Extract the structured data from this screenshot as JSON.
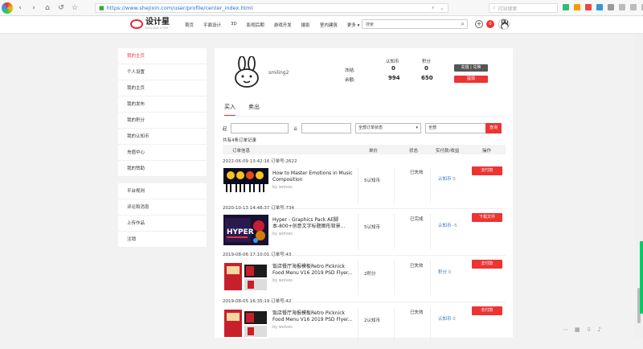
{
  "browser": {
    "url": "https://www.shejixin.com/user/profile/center_index.html",
    "search_placeholder": "闪站搜索",
    "colors": {
      "accent": "#e33333",
      "link": "#2a72c8"
    }
  },
  "header": {
    "logo_text": "设计星",
    "logo_sub": "DESIGN STAR",
    "menu": [
      "首页",
      "平面设计",
      "3D",
      "影视后期",
      "游戏开发",
      "摄影",
      "室内建筑",
      "更多"
    ],
    "search_value": "搜索",
    "notification_count": "0"
  },
  "sidebar": {
    "group1": [
      "我的主页",
      "个人设置",
      "我的主页",
      "我的发布",
      "我的积分",
      "我的认知币",
      "充值中心",
      "我的赞助"
    ],
    "group2": [
      "平台规则",
      "评论和消息",
      "上传作品",
      "注销"
    ]
  },
  "profile": {
    "username": "smiling2",
    "col_coins": "认知币",
    "col_points": "积分",
    "row_frozen": "冻结:",
    "row_balance": "余额:",
    "frozen_coins": "0",
    "frozen_points": "0",
    "balance_coins": "994",
    "balance_points": "650",
    "btn_recharge": "充值 | 兑换",
    "btn_withdraw": "提现"
  },
  "tabs": [
    "买入",
    "卖出"
  ],
  "filter": {
    "from_label": "起",
    "to_label": "止",
    "status_select": "全部订单状态",
    "type_select": "全部",
    "query_btn": "查询"
  },
  "count_text": "共有4条订单记录",
  "table_headers": [
    "订单信息",
    "单价",
    "状态",
    "实付款/收益",
    "操作"
  ],
  "orders": [
    {
      "date": "2022-06-09 13:42:16",
      "order_no": "订单号:2622",
      "title": "How to Master Emotions in Music Composition",
      "by": "by   wolves",
      "price": "5认知币",
      "status": "已失效",
      "paid": "认知币",
      "paid_num": "0",
      "action": "去付款"
    },
    {
      "date": "2020-10-13 14:48:37",
      "order_no": "订单号:734",
      "title": "Hyper - Graphics Pack AE脚本-800+创意文字标题图形背景...",
      "by": "by   wolves",
      "price": "5认知币",
      "status": "已完成",
      "paid": "认知币",
      "paid_num": "-5",
      "action": "下载文件"
    },
    {
      "date": "2019-08-06 17:10:01",
      "order_no": "订单号:43",
      "title": "饭店餐厅海报模板Retro Picknick Food Menu V16 2019 PSD Flyer...",
      "by": "by   wolves",
      "price": "2积分",
      "status": "已失效",
      "paid": "积分",
      "paid_num": "0",
      "action": "去付款"
    },
    {
      "date": "2019-08-05 16:35:19",
      "order_no": "订单号:42",
      "title": "饭店餐厅海报模板Retro Picknick Food Menu V16 2019 PSD Flyer...",
      "by": "by   wolves",
      "price": "2认知币",
      "status": "已失效",
      "paid": "认知币",
      "paid_num": "0",
      "action": "去付款"
    }
  ]
}
